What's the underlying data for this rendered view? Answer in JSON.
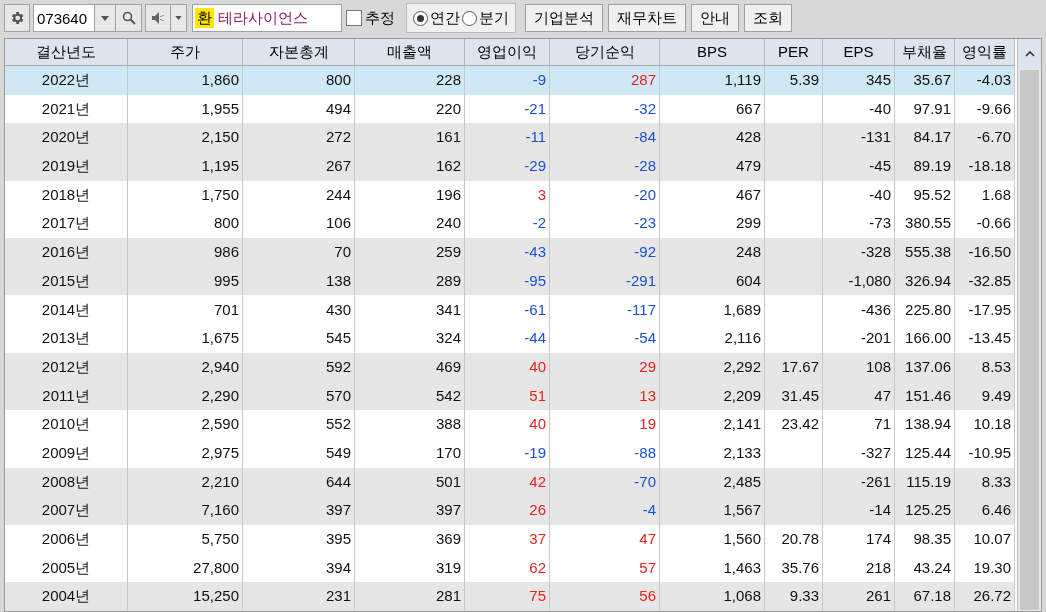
{
  "toolbar": {
    "code": "073640",
    "badge": "환",
    "name": "테라사이언스",
    "estimate": {
      "label": "추정",
      "checked": false
    },
    "period": [
      {
        "label": "연간",
        "selected": true
      },
      {
        "label": "분기",
        "selected": false
      }
    ],
    "buttons": [
      "기업분석",
      "재무차트",
      "안내",
      "조회"
    ]
  },
  "table": {
    "columns": [
      "결산년도",
      "주가",
      "자본총계",
      "매출액",
      "영업이익",
      "당기순익",
      "BPS",
      "PER",
      "EPS",
      "부채율",
      "영익률"
    ],
    "rows": [
      {
        "selected": true,
        "cells": [
          {
            "text": "2022년"
          },
          {
            "text": "1,860"
          },
          {
            "text": "800"
          },
          {
            "text": "228"
          },
          {
            "text": "-9",
            "color": "#1a4fd6"
          },
          {
            "text": "287",
            "color": "#e8201c"
          },
          {
            "text": "1,119"
          },
          {
            "text": "5.39"
          },
          {
            "text": "345"
          },
          {
            "text": "35.67"
          },
          {
            "text": "-4.03"
          }
        ]
      },
      {
        "selected": false,
        "cells": [
          {
            "text": "2021년"
          },
          {
            "text": "1,955"
          },
          {
            "text": "494"
          },
          {
            "text": "220"
          },
          {
            "text": "-21",
            "color": "#1a4fd6"
          },
          {
            "text": "-32",
            "color": "#1a4fd6"
          },
          {
            "text": "667"
          },
          {
            "text": ""
          },
          {
            "text": "-40"
          },
          {
            "text": "97.91"
          },
          {
            "text": "-9.66"
          }
        ]
      },
      {
        "selected": false,
        "cells": [
          {
            "text": "2020년"
          },
          {
            "text": "2,150"
          },
          {
            "text": "272"
          },
          {
            "text": "161"
          },
          {
            "text": "-11",
            "color": "#1a4fd6"
          },
          {
            "text": "-84",
            "color": "#1a4fd6"
          },
          {
            "text": "428"
          },
          {
            "text": ""
          },
          {
            "text": "-131"
          },
          {
            "text": "84.17"
          },
          {
            "text": "-6.70"
          }
        ]
      },
      {
        "selected": false,
        "cells": [
          {
            "text": "2019년"
          },
          {
            "text": "1,195"
          },
          {
            "text": "267"
          },
          {
            "text": "162"
          },
          {
            "text": "-29",
            "color": "#1a4fd6"
          },
          {
            "text": "-28",
            "color": "#1a4fd6"
          },
          {
            "text": "479"
          },
          {
            "text": ""
          },
          {
            "text": "-45"
          },
          {
            "text": "89.19"
          },
          {
            "text": "-18.18"
          }
        ]
      },
      {
        "selected": false,
        "cells": [
          {
            "text": "2018년"
          },
          {
            "text": "1,750"
          },
          {
            "text": "244"
          },
          {
            "text": "196"
          },
          {
            "text": "3",
            "color": "#e8201c"
          },
          {
            "text": "-20",
            "color": "#1a4fd6"
          },
          {
            "text": "467"
          },
          {
            "text": ""
          },
          {
            "text": "-40"
          },
          {
            "text": "95.52"
          },
          {
            "text": "1.68"
          }
        ]
      },
      {
        "selected": false,
        "cells": [
          {
            "text": "2017년"
          },
          {
            "text": "800"
          },
          {
            "text": "106"
          },
          {
            "text": "240"
          },
          {
            "text": "-2",
            "color": "#1a4fd6"
          },
          {
            "text": "-23",
            "color": "#1a4fd6"
          },
          {
            "text": "299"
          },
          {
            "text": ""
          },
          {
            "text": "-73"
          },
          {
            "text": "380.55"
          },
          {
            "text": "-0.66"
          }
        ]
      },
      {
        "selected": false,
        "cells": [
          {
            "text": "2016년"
          },
          {
            "text": "986"
          },
          {
            "text": "70"
          },
          {
            "text": "259"
          },
          {
            "text": "-43",
            "color": "#1a4fd6"
          },
          {
            "text": "-92",
            "color": "#1a4fd6"
          },
          {
            "text": "248"
          },
          {
            "text": ""
          },
          {
            "text": "-328"
          },
          {
            "text": "555.38"
          },
          {
            "text": "-16.50"
          }
        ]
      },
      {
        "selected": false,
        "cells": [
          {
            "text": "2015년"
          },
          {
            "text": "995"
          },
          {
            "text": "138"
          },
          {
            "text": "289"
          },
          {
            "text": "-95",
            "color": "#1a4fd6"
          },
          {
            "text": "-291",
            "color": "#1a4fd6"
          },
          {
            "text": "604"
          },
          {
            "text": ""
          },
          {
            "text": "-1,080"
          },
          {
            "text": "326.94"
          },
          {
            "text": "-32.85"
          }
        ]
      },
      {
        "selected": false,
        "cells": [
          {
            "text": "2014년"
          },
          {
            "text": "701"
          },
          {
            "text": "430"
          },
          {
            "text": "341"
          },
          {
            "text": "-61",
            "color": "#1a4fd6"
          },
          {
            "text": "-117",
            "color": "#1a4fd6"
          },
          {
            "text": "1,689"
          },
          {
            "text": ""
          },
          {
            "text": "-436"
          },
          {
            "text": "225.80"
          },
          {
            "text": "-17.95"
          }
        ]
      },
      {
        "selected": false,
        "cells": [
          {
            "text": "2013년"
          },
          {
            "text": "1,675"
          },
          {
            "text": "545"
          },
          {
            "text": "324"
          },
          {
            "text": "-44",
            "color": "#1a4fd6"
          },
          {
            "text": "-54",
            "color": "#1a4fd6"
          },
          {
            "text": "2,116"
          },
          {
            "text": ""
          },
          {
            "text": "-201"
          },
          {
            "text": "166.00"
          },
          {
            "text": "-13.45"
          }
        ]
      },
      {
        "selected": false,
        "cells": [
          {
            "text": "2012년"
          },
          {
            "text": "2,940"
          },
          {
            "text": "592"
          },
          {
            "text": "469"
          },
          {
            "text": "40",
            "color": "#e8201c"
          },
          {
            "text": "29",
            "color": "#e8201c"
          },
          {
            "text": "2,292"
          },
          {
            "text": "17.67"
          },
          {
            "text": "108"
          },
          {
            "text": "137.06"
          },
          {
            "text": "8.53"
          }
        ]
      },
      {
        "selected": false,
        "cells": [
          {
            "text": "2011년"
          },
          {
            "text": "2,290"
          },
          {
            "text": "570"
          },
          {
            "text": "542"
          },
          {
            "text": "51",
            "color": "#e8201c"
          },
          {
            "text": "13",
            "color": "#e8201c"
          },
          {
            "text": "2,209"
          },
          {
            "text": "31.45"
          },
          {
            "text": "47"
          },
          {
            "text": "151.46"
          },
          {
            "text": "9.49"
          }
        ]
      },
      {
        "selected": false,
        "cells": [
          {
            "text": "2010년"
          },
          {
            "text": "2,590"
          },
          {
            "text": "552"
          },
          {
            "text": "388"
          },
          {
            "text": "40",
            "color": "#e8201c"
          },
          {
            "text": "19",
            "color": "#e8201c"
          },
          {
            "text": "2,141"
          },
          {
            "text": "23.42"
          },
          {
            "text": "71"
          },
          {
            "text": "138.94"
          },
          {
            "text": "10.18"
          }
        ]
      },
      {
        "selected": false,
        "cells": [
          {
            "text": "2009년"
          },
          {
            "text": "2,975"
          },
          {
            "text": "549"
          },
          {
            "text": "170"
          },
          {
            "text": "-19",
            "color": "#1a4fd6"
          },
          {
            "text": "-88",
            "color": "#1a4fd6"
          },
          {
            "text": "2,133"
          },
          {
            "text": ""
          },
          {
            "text": "-327"
          },
          {
            "text": "125.44"
          },
          {
            "text": "-10.95"
          }
        ]
      },
      {
        "selected": false,
        "cells": [
          {
            "text": "2008년"
          },
          {
            "text": "2,210"
          },
          {
            "text": "644"
          },
          {
            "text": "501"
          },
          {
            "text": "42",
            "color": "#e8201c"
          },
          {
            "text": "-70",
            "color": "#1a4fd6"
          },
          {
            "text": "2,485"
          },
          {
            "text": ""
          },
          {
            "text": "-261"
          },
          {
            "text": "115.19"
          },
          {
            "text": "8.33"
          }
        ]
      },
      {
        "selected": false,
        "cells": [
          {
            "text": "2007년"
          },
          {
            "text": "7,160"
          },
          {
            "text": "397"
          },
          {
            "text": "397"
          },
          {
            "text": "26",
            "color": "#e8201c"
          },
          {
            "text": "-4",
            "color": "#1a4fd6"
          },
          {
            "text": "1,567"
          },
          {
            "text": ""
          },
          {
            "text": "-14"
          },
          {
            "text": "125.25"
          },
          {
            "text": "6.46"
          }
        ]
      },
      {
        "selected": false,
        "cells": [
          {
            "text": "2006년"
          },
          {
            "text": "5,750"
          },
          {
            "text": "395"
          },
          {
            "text": "369"
          },
          {
            "text": "37",
            "color": "#e8201c"
          },
          {
            "text": "47",
            "color": "#e8201c"
          },
          {
            "text": "1,560"
          },
          {
            "text": "20.78"
          },
          {
            "text": "174"
          },
          {
            "text": "98.35"
          },
          {
            "text": "10.07"
          }
        ]
      },
      {
        "selected": false,
        "cells": [
          {
            "text": "2005년"
          },
          {
            "text": "27,800"
          },
          {
            "text": "394"
          },
          {
            "text": "319"
          },
          {
            "text": "62",
            "color": "#e8201c"
          },
          {
            "text": "57",
            "color": "#e8201c"
          },
          {
            "text": "1,463"
          },
          {
            "text": "35.76"
          },
          {
            "text": "218"
          },
          {
            "text": "43.24"
          },
          {
            "text": "19.30"
          }
        ]
      },
      {
        "selected": false,
        "cells": [
          {
            "text": "2004년"
          },
          {
            "text": "15,250"
          },
          {
            "text": "231"
          },
          {
            "text": "281"
          },
          {
            "text": "75",
            "color": "#e8201c"
          },
          {
            "text": "56",
            "color": "#e8201c"
          },
          {
            "text": "1,068"
          },
          {
            "text": "9.33"
          },
          {
            "text": "261"
          },
          {
            "text": "67.18"
          },
          {
            "text": "26.72"
          }
        ]
      }
    ]
  }
}
